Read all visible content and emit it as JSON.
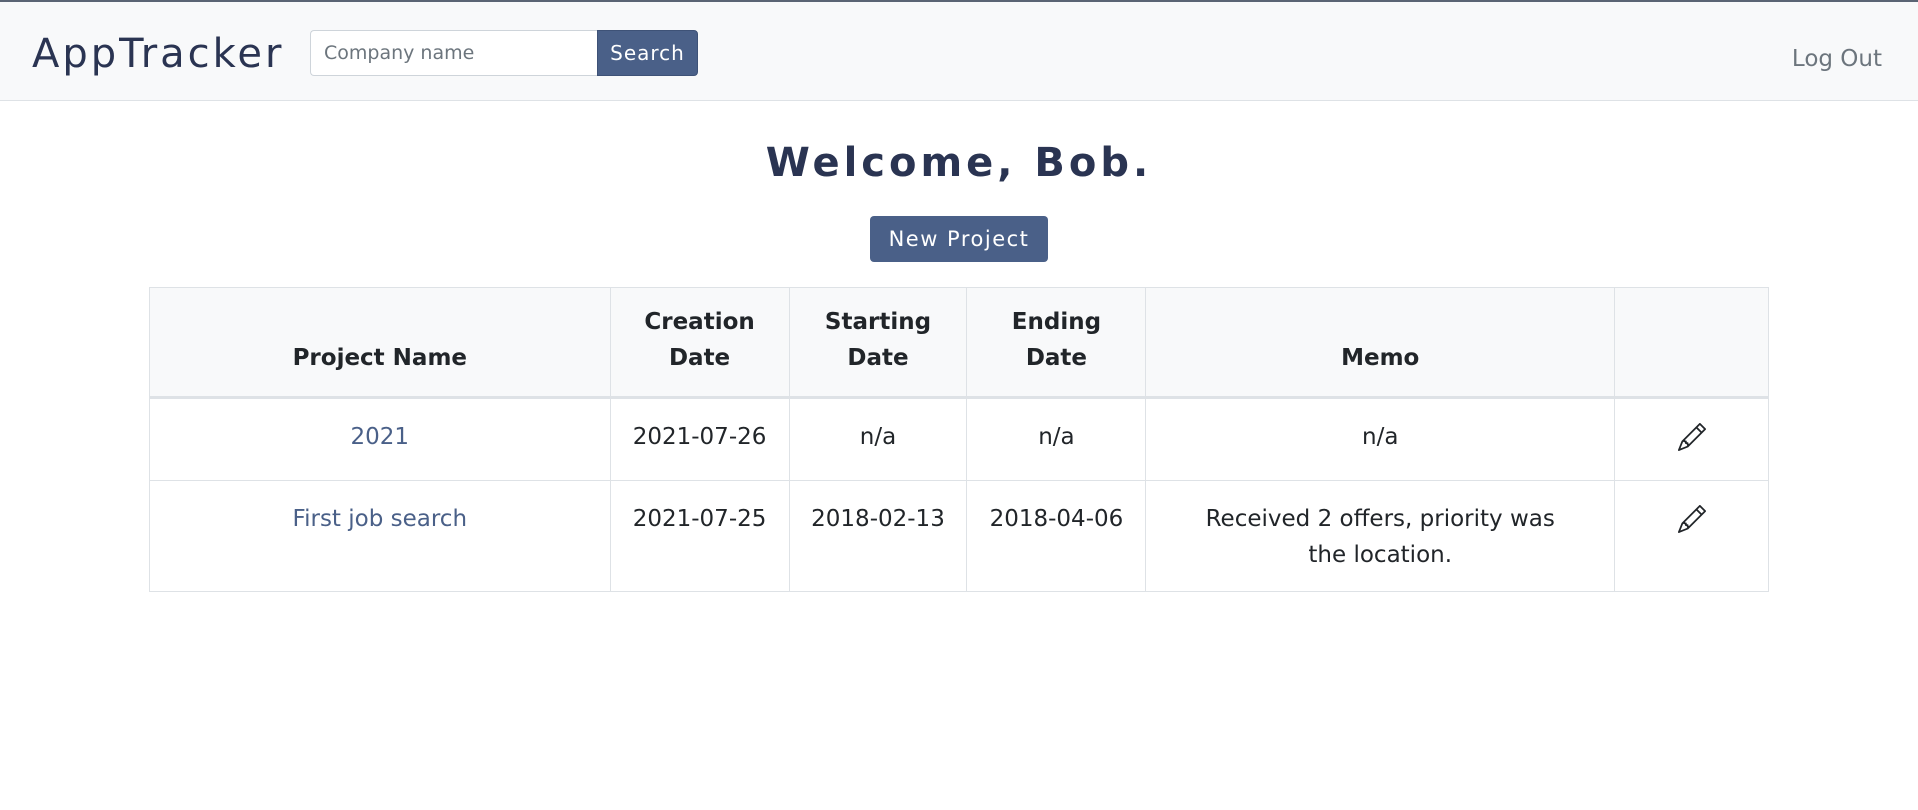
{
  "navbar": {
    "brand": "AppTracker",
    "search_placeholder": "Company name",
    "search_value": "",
    "search_button": "Search",
    "logout": "Log Out"
  },
  "main": {
    "welcome": "Welcome, Bob.",
    "new_project_label": "New Project"
  },
  "table": {
    "headers": {
      "project_name": "Project Name",
      "creation_date": "Creation Date",
      "starting_date": "Starting Date",
      "ending_date": "Ending Date",
      "memo": "Memo",
      "actions": ""
    },
    "rows": [
      {
        "project_name": "2021",
        "creation_date": "2021-07-26",
        "starting_date": "n/a",
        "ending_date": "n/a",
        "memo": "n/a",
        "edit_icon": "pencil-icon"
      },
      {
        "project_name": "First job search",
        "creation_date": "2021-07-25",
        "starting_date": "2018-02-13",
        "ending_date": "2018-04-06",
        "memo": "Received 2 offers, priority was the location.",
        "edit_icon": "pencil-icon"
      }
    ]
  },
  "colors": {
    "brand_text": "#2a3452",
    "primary_button": "#4a6088",
    "link": "#4a6088",
    "navbar_bg": "#f8f9fa"
  }
}
